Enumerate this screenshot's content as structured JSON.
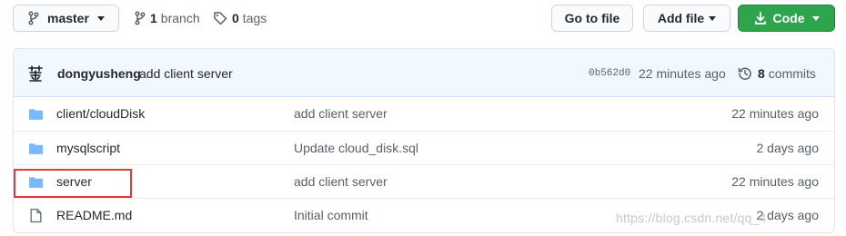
{
  "toolbar": {
    "branch_select": "master",
    "branches_count": "1",
    "branches_label": "branch",
    "tags_count": "0",
    "tags_label": "tags",
    "goto_file": "Go to file",
    "add_file": "Add file",
    "code": "Code",
    "code_color": "#2ea44f"
  },
  "latest_commit": {
    "author": "dongyusheng",
    "message": "add client server",
    "sha": "0b562d0",
    "time": "22 minutes ago",
    "commits_count": "8",
    "commits_label": "commits"
  },
  "files": [
    {
      "icon": "folder-icon",
      "name": "client/cloudDisk",
      "message": "add client server",
      "age": "22 minutes ago"
    },
    {
      "icon": "folder-icon",
      "name": "mysqlscript",
      "message": "Update cloud_disk.sql",
      "age": "2 days ago"
    },
    {
      "icon": "folder-icon",
      "name": "server",
      "message": "add client server",
      "age": "22 minutes ago"
    },
    {
      "icon": "file-icon",
      "name": "README.md",
      "message": "Initial commit",
      "age": "2 days ago"
    }
  ],
  "annotation": {
    "highlight_color": "#e0393e"
  },
  "watermark": "https://blog.csdn.net/qq_4"
}
